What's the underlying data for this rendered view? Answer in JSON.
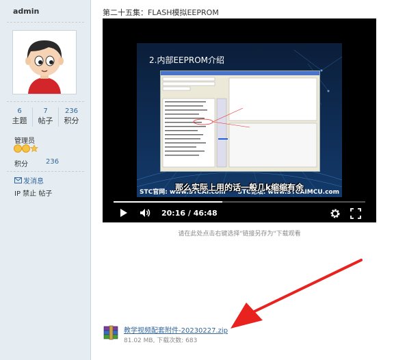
{
  "user": {
    "name": "admin",
    "stats": [
      {
        "num": "6",
        "label": "主题"
      },
      {
        "num": "7",
        "label": "帖子"
      },
      {
        "num": "236",
        "label": "积分"
      }
    ],
    "group": "管理员",
    "jifen_label": "积分",
    "jifen_value": "236",
    "send_message": "发消息",
    "ip_ban": "IP 禁止 帖子"
  },
  "post": {
    "title": "第二十五集：FLASH模拟EEPROM"
  },
  "video": {
    "slide_title": "2.内部EEPROM介绍",
    "subtitle": "那么实际上用的话一般几k缩缩有余",
    "watermark_left": "STC官网: www.STCAI.com",
    "watermark_right": "STC论坛: www.STCAIMCU.com",
    "time": "20:16 / 46:48",
    "progress": 0.433,
    "hint": "请在此处点击右键选择\"链接另存为\"下载观看"
  },
  "attachment": {
    "name": "教学视频配套附件-20230227.zip",
    "meta": "81.02 MB, 下载次数: 683"
  },
  "colors": {
    "sidebar_bg": "#e5edf2",
    "link": "#336699",
    "arrow": "#e8231f"
  }
}
